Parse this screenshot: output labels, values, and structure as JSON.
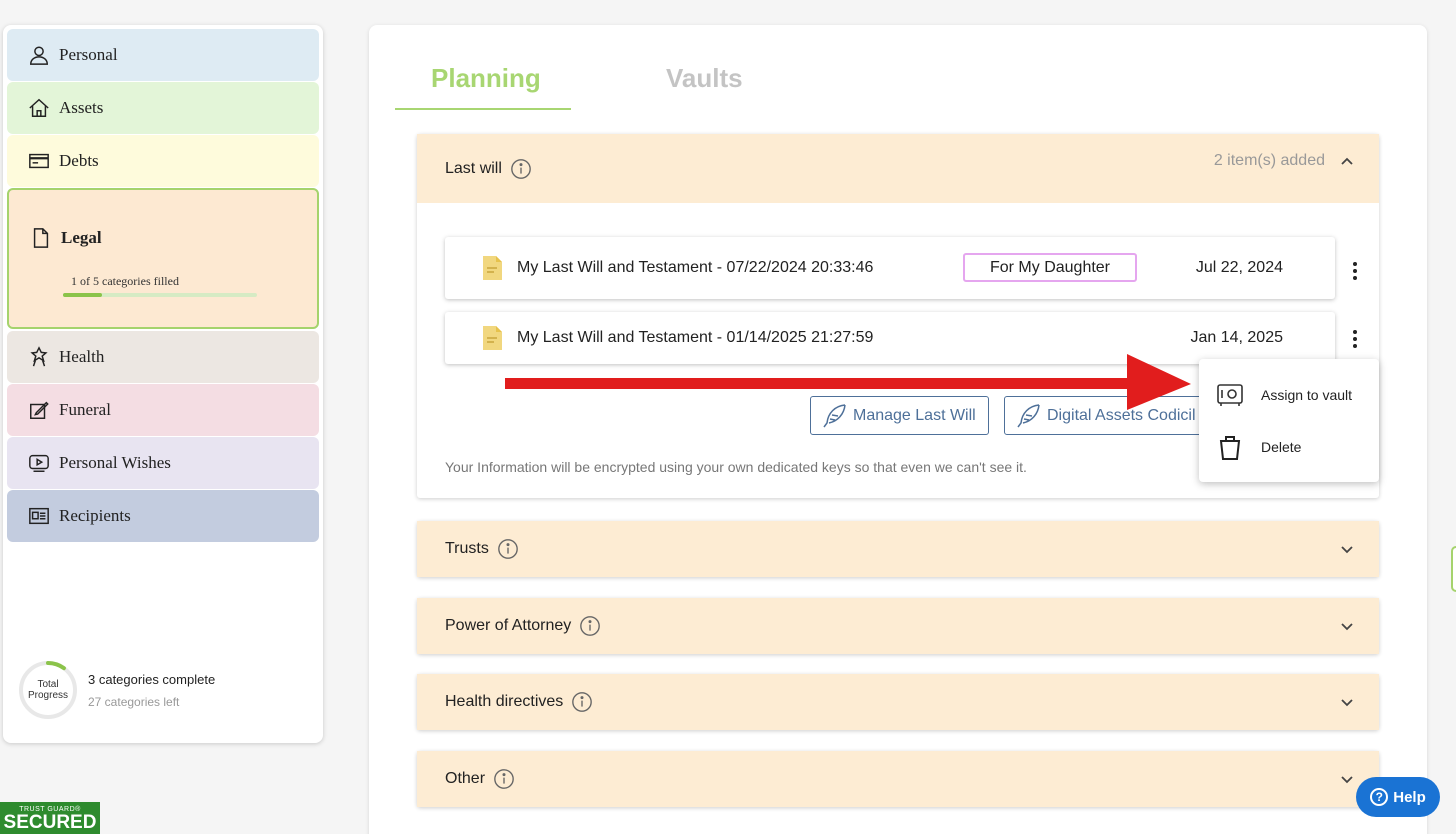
{
  "sidebar": {
    "items": [
      {
        "label": "Personal",
        "icon": "person-icon"
      },
      {
        "label": "Assets",
        "icon": "house-icon"
      },
      {
        "label": "Debts",
        "icon": "card-icon"
      },
      {
        "label": "Legal",
        "icon": "document-icon"
      },
      {
        "label": "Health",
        "icon": "health-icon"
      },
      {
        "label": "Funeral",
        "icon": "funeral-icon"
      },
      {
        "label": "Personal Wishes",
        "icon": "video-icon"
      },
      {
        "label": "Recipients",
        "icon": "id-card-icon"
      }
    ],
    "legal_progress_text": "1 of 5 categories filled",
    "legal_progress_fraction": 0.2
  },
  "progress": {
    "ring_label_1": "Total",
    "ring_label_2": "Progress",
    "complete_text": "3 categories complete",
    "left_text": "27 categories left",
    "fraction": 0.1
  },
  "trust_badge": {
    "top": "TRUST GUARD®",
    "main": "SECURED"
  },
  "tabs": [
    {
      "label": "Planning",
      "active": true
    },
    {
      "label": "Vaults",
      "active": false
    }
  ],
  "sections": {
    "last_will": {
      "title": "Last will",
      "count": "2 item(s) added",
      "items": [
        {
          "name": "My Last Will and Testament - 07/22/2024 20:33:46",
          "tag": "For My Daughter",
          "date": "Jul 22, 2024"
        },
        {
          "name": "My Last Will and Testament - 01/14/2025 21:27:59",
          "tag": "",
          "date": "Jan 14, 2025"
        }
      ],
      "manage_button": "Manage Last Will",
      "codicil_button": "Digital Assets Codicil",
      "note": "Your Information will be encrypted using your own dedicated keys so that even we can't see it."
    },
    "trusts": {
      "title": "Trusts"
    },
    "poa": {
      "title": "Power of Attorney"
    },
    "health_directives": {
      "title": "Health directives"
    },
    "other": {
      "title": "Other"
    }
  },
  "context_menu": {
    "assign": "Assign to vault",
    "delete": "Delete"
  },
  "help_button": "Help",
  "colors": {
    "accent_green": "#a8d672",
    "section_header": "#fdecd3",
    "button_blue": "#4e7099",
    "help_blue": "#1a73d4",
    "arrow_red": "#e11d1d"
  }
}
